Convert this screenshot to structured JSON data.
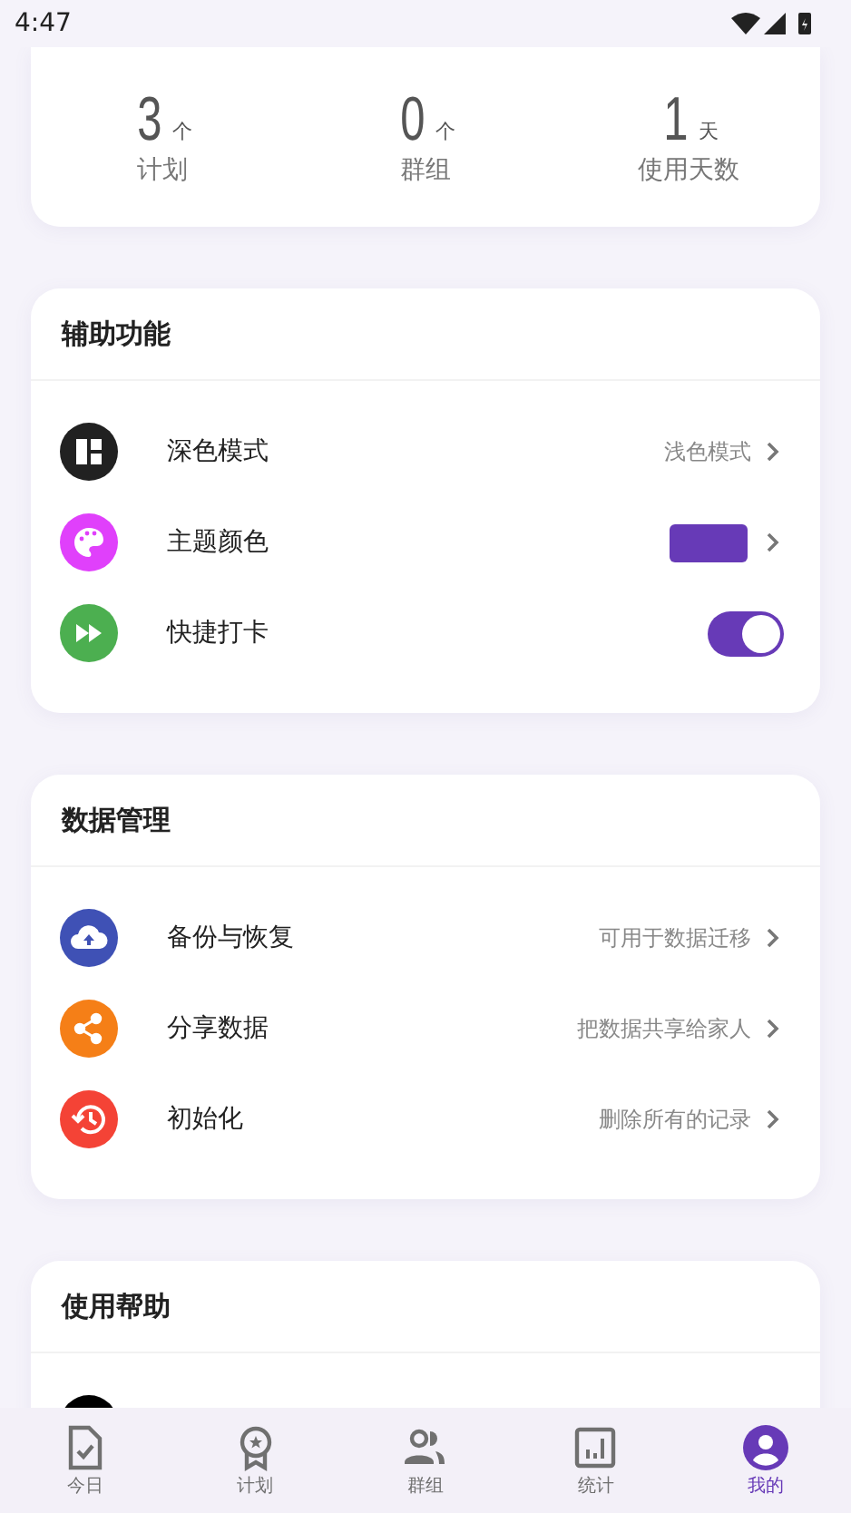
{
  "status_bar": {
    "time": "4:47"
  },
  "stats": [
    {
      "value": "3",
      "unit": "个",
      "label": "计划"
    },
    {
      "value": "0",
      "unit": "个",
      "label": "群组"
    },
    {
      "value": "1",
      "unit": "天",
      "label": "使用天数"
    }
  ],
  "assist": {
    "title": "辅助功能",
    "items": [
      {
        "kind": "value",
        "label": "深色模式",
        "value": "浅色模式",
        "color": "#212121"
      },
      {
        "kind": "color",
        "label": "主题颜色",
        "swatch": {
          "color": "#673ab7"
        },
        "color": "#e040fb"
      },
      {
        "kind": "toggle",
        "label": "快捷打卡",
        "on": true,
        "color": "#4caf50"
      }
    ]
  },
  "data": {
    "title": "数据管理",
    "items": [
      {
        "kind": "value",
        "label": "备份与恢复",
        "value": "可用于数据迁移",
        "color": "#3f51b5"
      },
      {
        "kind": "value",
        "label": "分享数据",
        "value": "把数据共享给家人",
        "color": "#f57f17"
      },
      {
        "kind": "value",
        "label": "初始化",
        "value": "删除所有的记录",
        "color": "#f44336"
      }
    ]
  },
  "help": {
    "title": "使用帮助",
    "items": [
      {
        "color": "#000000"
      }
    ]
  },
  "nav": [
    {
      "label": "今日",
      "selected": false
    },
    {
      "label": "计划",
      "selected": false
    },
    {
      "label": "群组",
      "selected": false
    },
    {
      "label": "统计",
      "selected": false
    },
    {
      "label": "我的",
      "selected": true
    }
  ]
}
